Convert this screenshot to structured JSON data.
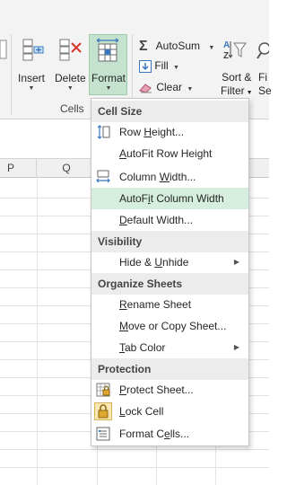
{
  "ribbon": {
    "insert_label": "Insert",
    "delete_label": "Delete",
    "format_label": "Format",
    "cells_group_label": "Cells",
    "autosum_label": "AutoSum",
    "fill_label": "Fill",
    "clear_label": "Clear",
    "sort_label_line1": "Sort &",
    "sort_label_line2": "Filter",
    "find_label_line1": "Fi",
    "find_label_line2": "Se",
    "accent_color": "#217346"
  },
  "grid": {
    "columns": [
      "P",
      "Q"
    ]
  },
  "menu": {
    "sections": [
      {
        "title": "Cell Size"
      },
      {
        "title": "Visibility"
      },
      {
        "title": "Organize Sheets"
      },
      {
        "title": "Protection"
      }
    ],
    "items": {
      "row_height": {
        "pre": "Row ",
        "ul": "H",
        "post": "eight..."
      },
      "autofit_row_height": {
        "pre": "",
        "ul": "A",
        "post": "utoFit Row Height"
      },
      "column_width": {
        "pre": "Column ",
        "ul": "W",
        "post": "idth..."
      },
      "autofit_column_width": {
        "pre": "AutoF",
        "ul": "i",
        "post": "t Column Width"
      },
      "default_width": {
        "pre": "",
        "ul": "D",
        "post": "efault Width..."
      },
      "hide_unhide": {
        "pre": "Hide & ",
        "ul": "U",
        "post": "nhide"
      },
      "rename_sheet": {
        "pre": "",
        "ul": "R",
        "post": "ename Sheet"
      },
      "move_copy_sheet": {
        "pre": "",
        "ul": "M",
        "post": "ove or Copy Sheet..."
      },
      "tab_color": {
        "pre": "",
        "ul": "T",
        "post": "ab Color"
      },
      "protect_sheet": {
        "pre": "",
        "ul": "P",
        "post": "rotect Sheet..."
      },
      "lock_cell": {
        "pre": "",
        "ul": "L",
        "post": "ock Cell"
      },
      "format_cells": {
        "pre": "Format C",
        "ul": "e",
        "post": "lls..."
      }
    },
    "highlight_color": "#d5eedd"
  }
}
